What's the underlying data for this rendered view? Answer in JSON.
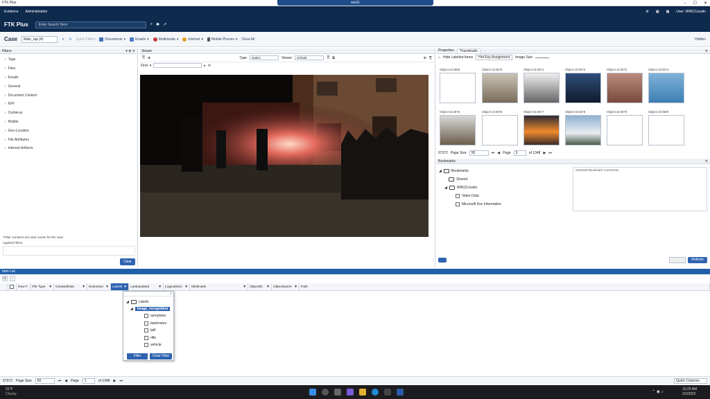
{
  "window": {
    "title": "FTK Plus",
    "rdp_title": "win11"
  },
  "nav": {
    "evidence": "Evidence",
    "administration": "Administration",
    "user": "User: WIN11\\Justin"
  },
  "header": {
    "logo": "FTK Plus",
    "search_placeholder": "Enter Search Term"
  },
  "toolbar": {
    "case_label": "Case",
    "case_value": "Main_rap (4)",
    "quick_filters": "Quick Filters",
    "documents": "Documents",
    "emails": "Emails",
    "multimedia": "Multimedia",
    "internet": "Internet",
    "mobile_phones": "Mobile Phones",
    "clear_all": "Clear All",
    "hidden": "Hidden"
  },
  "filters": {
    "title": "Filters",
    "items": [
      "Tags",
      "Files",
      "Emails",
      "General",
      "Document Content",
      "KFF",
      "Cerberus",
      "Mobile",
      "Geo-Location",
      "File Attributes",
      "Internet Artifacts"
    ],
    "note": "*Filter numbers are total counts for the case",
    "applied": "Applied Filters",
    "clear": "Clear"
  },
  "viewer": {
    "title": "Viewer",
    "type_label": "Type",
    "type_value": "Native",
    "viewer_label": "Viewer",
    "viewer_value": "Default",
    "find_label": "Find"
  },
  "properties": {
    "tab1": "Properties",
    "tab2": "Thumbnails",
    "hide_labeled": "Hide Labeled Items",
    "assignment": "Hot Key Assignment",
    "image_size": "Image Size",
    "thumbs": [
      "Object Id:3569",
      "Object Id:3570",
      "Object Id:3571",
      "Object Id:3572",
      "Object Id:3573",
      "Object Id:3574",
      "Object Id:3575",
      "Object Id:3576",
      "Object Id:3577",
      "Object Id:3578",
      "Object Id:3579",
      "Object Id:3580"
    ],
    "count": "67372",
    "page_size_label": "Page Size",
    "page_size": "50",
    "page_label": "Page",
    "page": "5",
    "of_pages": "of 1348"
  },
  "bookmarks": {
    "title": "Bookmarks",
    "root": "Bookmarks",
    "shared": "Shared",
    "user": "WIN11\\Justin",
    "items": [
      "Video Data",
      "Microsoft Doc Information"
    ],
    "comments": "Selected Bookmark Comments",
    "refresh": "Refresh"
  },
  "itemlist": {
    "title": "Item List",
    "columns": [
      "Row #",
      "File Type",
      "CreatedDate",
      "Extension",
      "Labels",
      "LastUpdated",
      "LogicalSize",
      "MD5Hash",
      "ObjectID",
      "ObjectName",
      "Path"
    ],
    "popup": {
      "root": "Labels",
      "group": "Image_recognition",
      "options": [
        "aeroplane",
        "banknotes",
        "Ipill",
        "rifle",
        "vehicle"
      ],
      "filter": "Filter",
      "clear": "Clear Filter"
    },
    "count": "67372",
    "page_size_label": "Page Size",
    "page_size": "50",
    "page_label": "Page",
    "page": "1",
    "of_pages": "of 1348",
    "quick_columns": "Quick Columns"
  },
  "taskbar": {
    "temp": "31°F",
    "weather": "Cloudy",
    "time": "10:25 AM",
    "date": "2/2/2022"
  }
}
